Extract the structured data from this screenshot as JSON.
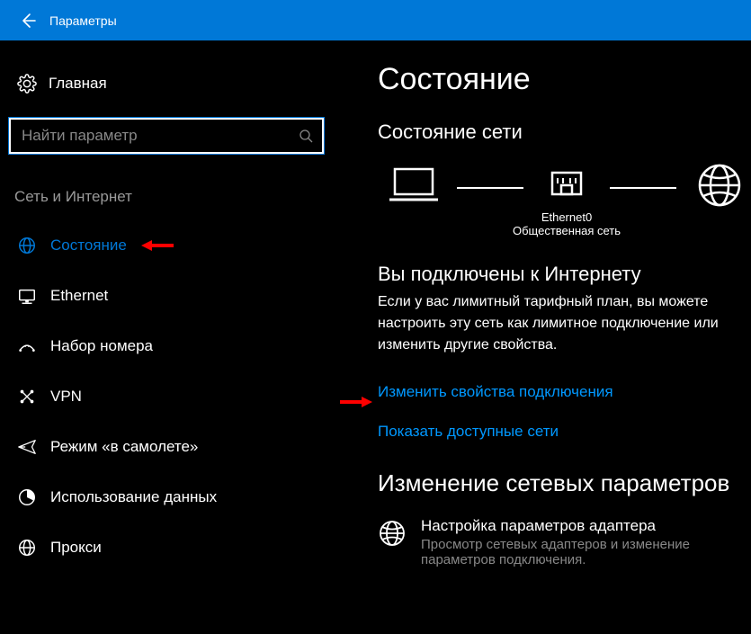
{
  "titlebar": {
    "title": "Параметры"
  },
  "sidebar": {
    "home": "Главная",
    "search_placeholder": "Найти параметр",
    "section": "Сеть и Интернет",
    "items": [
      {
        "key": "status",
        "label": "Состояние",
        "icon": "globe",
        "active": true,
        "arrow": true
      },
      {
        "key": "ethernet",
        "label": "Ethernet",
        "icon": "ethernet"
      },
      {
        "key": "dialup",
        "label": "Набор номера",
        "icon": "dialup"
      },
      {
        "key": "vpn",
        "label": "VPN",
        "icon": "vpn"
      },
      {
        "key": "airplane",
        "label": "Режим «в самолете»",
        "icon": "airplane"
      },
      {
        "key": "datausage",
        "label": "Использование данных",
        "icon": "datausage"
      },
      {
        "key": "proxy",
        "label": "Прокси",
        "icon": "proxy"
      }
    ]
  },
  "content": {
    "title": "Состояние",
    "net_status_heading": "Состояние сети",
    "diagram": {
      "adapter": "Ethernet0",
      "network_type": "Общественная сеть"
    },
    "connected_heading": "Вы подключены к Интернету",
    "connected_body": "Если у вас лимитный тарифный план, вы можете настроить эту сеть как лимитное подключение или изменить другие свойства.",
    "link_change_props": "Изменить свойства подключения",
    "link_show_networks": "Показать доступные сети",
    "change_params_heading": "Изменение сетевых параметров",
    "adapter_settings": {
      "title": "Настройка параметров адаптера",
      "desc": "Просмотр сетевых адаптеров и изменение параметров подключения."
    }
  },
  "colors": {
    "accent": "#0078d7",
    "link": "#0098ff",
    "arrow": "#ff0000"
  }
}
